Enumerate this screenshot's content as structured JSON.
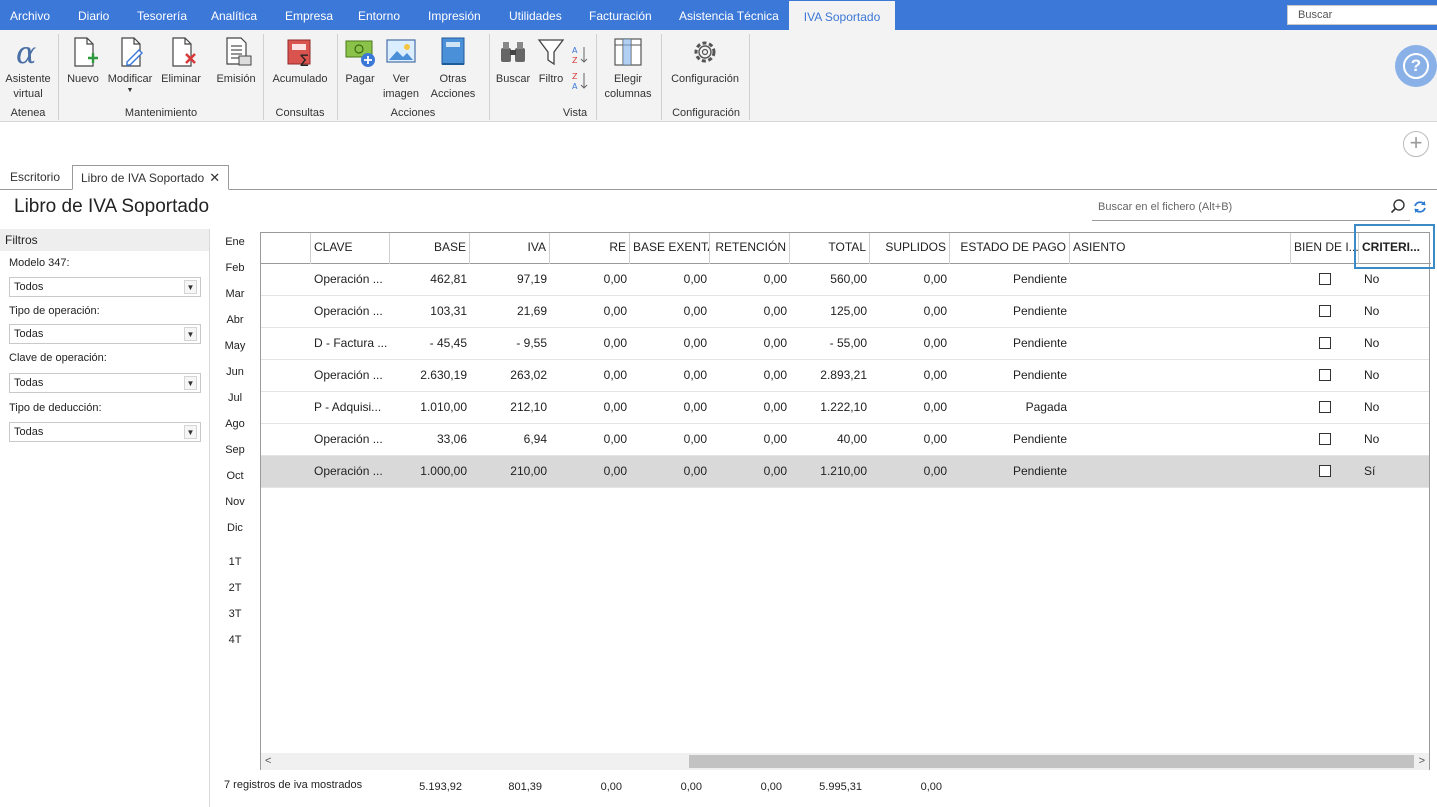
{
  "menu": {
    "items": [
      "Archivo",
      "Diario",
      "Tesorería",
      "Analítica",
      "Empresa",
      "Entorno",
      "Impresión",
      "Utilidades",
      "Facturación",
      "Asistencia Técnica"
    ],
    "active": "IVA Soportado",
    "search_placeholder": "Buscar"
  },
  "ribbon": {
    "buttons": {
      "asistente": "Asistente virtual",
      "nuevo": "Nuevo",
      "modificar": "Modificar",
      "eliminar": "Eliminar",
      "emision": "Emisión",
      "acumulado": "Acumulado",
      "pagar": "Pagar",
      "ver_imagen": "Ver imagen",
      "otras_acciones": "Otras Acciones",
      "buscar": "Buscar",
      "filtro": "Filtro",
      "elegir_columnas": "Elegir columnas",
      "configuracion": "Configuración"
    },
    "groups": {
      "atenea": "Atenea",
      "mantenimiento": "Mantenimiento",
      "consultas": "Consultas",
      "acciones": "Acciones",
      "vista": "Vista",
      "configuracion": "Configuración"
    }
  },
  "tabs": {
    "escritorio": "Escritorio",
    "libro": "Libro de IVA Soportado"
  },
  "page": {
    "title": "Libro de IVA Soportado",
    "search_placeholder": "Buscar en el fichero (Alt+B)"
  },
  "filters": {
    "header": "Filtros",
    "modelo347_label": "Modelo 347:",
    "modelo347_value": "Todos",
    "tipo_operacion_label": "Tipo de operación:",
    "tipo_operacion_value": "Todas",
    "clave_operacion_label": "Clave de operación:",
    "clave_operacion_value": "Todas",
    "tipo_deduccion_label": "Tipo de deducción:",
    "tipo_deduccion_value": "Todas"
  },
  "months": [
    "Ene",
    "Feb",
    "Mar",
    "Abr",
    "May",
    "Jun",
    "Jul",
    "Ago",
    "Sep",
    "Oct",
    "Nov",
    "Dic"
  ],
  "quarters": [
    "1T",
    "2T",
    "3T",
    "4T"
  ],
  "table": {
    "headers": {
      "clave": "CLAVE",
      "base": "BASE",
      "iva": "IVA",
      "re": "RE",
      "base_exenta": "BASE EXENTA",
      "retencion": "RETENCIÓN",
      "total": "TOTAL",
      "suplidos": "SUPLIDOS",
      "estado": "ESTADO DE PAGO",
      "asiento": "ASIENTO",
      "bien": "BIEN DE I...",
      "criterio": "CRITERI..."
    },
    "rows": [
      {
        "clave": "Operación ...",
        "base": "462,81",
        "iva": "97,19",
        "re": "0,00",
        "base_exenta": "0,00",
        "retencion": "0,00",
        "total": "560,00",
        "suplidos": "0,00",
        "estado": "Pendiente",
        "asiento": "",
        "bien": false,
        "criterio": "No"
      },
      {
        "clave": "Operación ...",
        "base": "103,31",
        "iva": "21,69",
        "re": "0,00",
        "base_exenta": "0,00",
        "retencion": "0,00",
        "total": "125,00",
        "suplidos": "0,00",
        "estado": "Pendiente",
        "asiento": "",
        "bien": false,
        "criterio": "No"
      },
      {
        "clave": "D - Factura ...",
        "base": "- 45,45",
        "iva": "- 9,55",
        "re": "0,00",
        "base_exenta": "0,00",
        "retencion": "0,00",
        "total": "- 55,00",
        "suplidos": "0,00",
        "estado": "Pendiente",
        "asiento": "",
        "bien": false,
        "criterio": "No"
      },
      {
        "clave": "Operación ...",
        "base": "2.630,19",
        "iva": "263,02",
        "re": "0,00",
        "base_exenta": "0,00",
        "retencion": "0,00",
        "total": "2.893,21",
        "suplidos": "0,00",
        "estado": "Pendiente",
        "asiento": "",
        "bien": false,
        "criterio": "No"
      },
      {
        "clave": "P - Adquisi...",
        "base": "1.010,00",
        "iva": "212,10",
        "re": "0,00",
        "base_exenta": "0,00",
        "retencion": "0,00",
        "total": "1.222,10",
        "suplidos": "0,00",
        "estado": "Pagada",
        "asiento": "",
        "bien": false,
        "criterio": "No"
      },
      {
        "clave": "Operación ...",
        "base": "33,06",
        "iva": "6,94",
        "re": "0,00",
        "base_exenta": "0,00",
        "retencion": "0,00",
        "total": "40,00",
        "suplidos": "0,00",
        "estado": "Pendiente",
        "asiento": "",
        "bien": false,
        "criterio": "No"
      },
      {
        "clave": "Operación ...",
        "base": "1.000,00",
        "iva": "210,00",
        "re": "0,00",
        "base_exenta": "0,00",
        "retencion": "0,00",
        "total": "1.210,00",
        "suplidos": "0,00",
        "estado": "Pendiente",
        "asiento": "",
        "bien": false,
        "criterio": "Sí"
      }
    ],
    "selected_row": 6
  },
  "footer": {
    "count_text": "7 registros de iva mostrados",
    "totals": {
      "base": "5.193,92",
      "iva": "801,39",
      "re": "0,00",
      "base_exenta": "0,00",
      "retencion": "0,00",
      "total": "5.995,31",
      "suplidos": "0,00"
    }
  },
  "colors": {
    "accent": "#3c78d8",
    "selected_row": "#d9d9d9",
    "highlight_frame": "#3c8bc6"
  }
}
